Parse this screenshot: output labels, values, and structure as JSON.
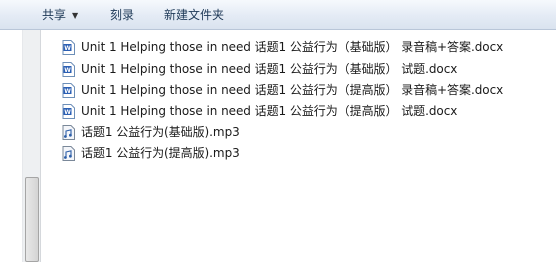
{
  "toolbar": {
    "share_label": "共享",
    "burn_label": "刻录",
    "new_folder_label": "新建文件夹"
  },
  "files": [
    {
      "name": "Unit 1 Helping those in need 话题1 公益行为（基础版） 录音稿+答案.docx",
      "icon": "word-doc-icon"
    },
    {
      "name": "Unit 1 Helping those in need 话题1 公益行为（基础版） 试题.docx",
      "icon": "word-doc-icon"
    },
    {
      "name": "Unit 1 Helping those in need 话题1 公益行为（提高版） 录音稿+答案.docx",
      "icon": "word-doc-icon"
    },
    {
      "name": "Unit 1 Helping those in need 话题1 公益行为（提高版） 试题.docx",
      "icon": "word-doc-icon"
    },
    {
      "name": "话题1 公益行为(基础版).mp3",
      "icon": "audio-file-icon"
    },
    {
      "name": "话题1 公益行为(提高版).mp3",
      "icon": "audio-file-icon"
    }
  ]
}
